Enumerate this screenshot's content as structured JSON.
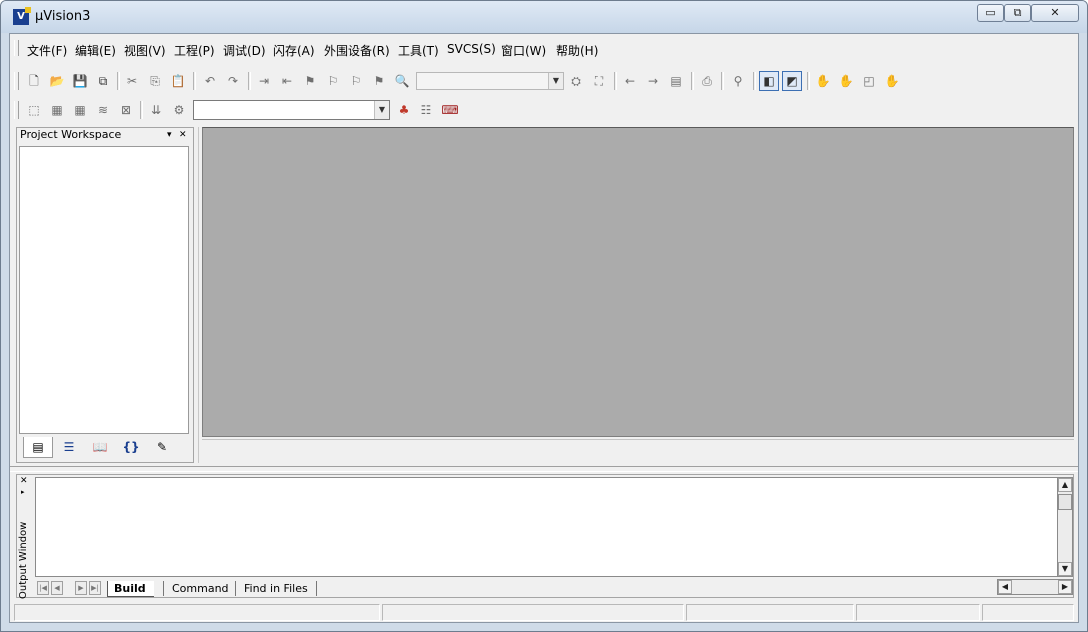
{
  "window": {
    "title": "µVision3",
    "icon_text": "V",
    "minimize": "▭",
    "restore": "⧉",
    "close": "✕"
  },
  "menu": [
    "文件(F)",
    "编辑(E)",
    "视图(V)",
    "工程(P)",
    "调试(D)",
    "闪存(A)",
    "外围设备(R)",
    "工具(T)",
    "SVCS(S)",
    "窗口(W)",
    "帮助(H)"
  ],
  "workspace": {
    "title": "Project Workspace",
    "pin": "▾",
    "close": "✕",
    "tabs": [
      "files-icon",
      "regs-icon",
      "books-icon",
      "functions-icon",
      "templates-icon"
    ]
  },
  "output": {
    "title": "Output Window",
    "close": "✕",
    "pin": "▸",
    "tabs": [
      "Build",
      "Command",
      "Find in Files"
    ],
    "active_tab": "Build"
  }
}
